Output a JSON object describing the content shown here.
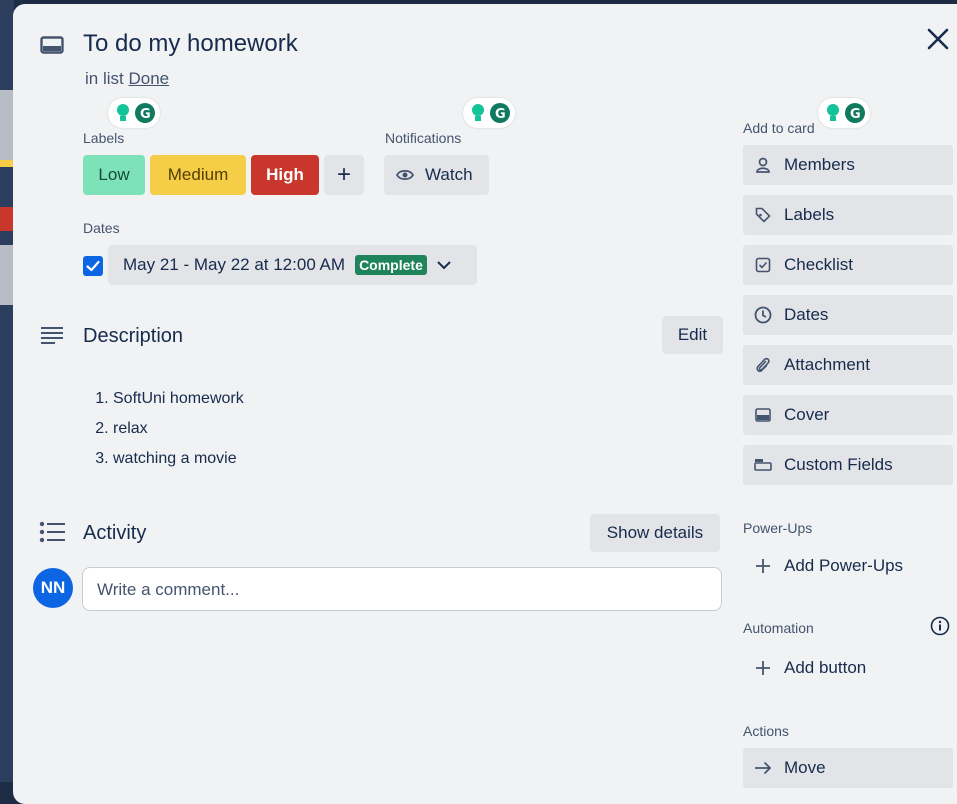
{
  "card": {
    "title": "To do my homework",
    "in_list_prefix": "in list",
    "list_name": "Done"
  },
  "labels": {
    "heading": "Labels",
    "items": [
      {
        "text": "Low",
        "color": "#7ee2b8"
      },
      {
        "text": "Medium",
        "color": "#f5cd47"
      },
      {
        "text": "High",
        "color": "#c9372c"
      }
    ],
    "add_symbol": "+"
  },
  "notifications": {
    "heading": "Notifications",
    "watch_label": "Watch"
  },
  "dates": {
    "heading": "Dates",
    "value": "May 21 - May 22 at 12:00 AM",
    "status": "Complete",
    "checked": true
  },
  "description": {
    "heading": "Description",
    "edit_label": "Edit",
    "items": [
      "SoftUni homework",
      "relax",
      "watching a movie"
    ]
  },
  "activity": {
    "heading": "Activity",
    "show_details_label": "Show details",
    "comment_placeholder": "Write a comment...",
    "avatar_initials": "NN"
  },
  "sidebar": {
    "add_to_card_heading": "Add to card",
    "add_to_card": [
      {
        "label": "Members",
        "icon": "person-icon"
      },
      {
        "label": "Labels",
        "icon": "tag-icon"
      },
      {
        "label": "Checklist",
        "icon": "checkbox-icon"
      },
      {
        "label": "Dates",
        "icon": "clock-icon"
      },
      {
        "label": "Attachment",
        "icon": "paperclip-icon"
      },
      {
        "label": "Cover",
        "icon": "cover-icon"
      },
      {
        "label": "Custom Fields",
        "icon": "fields-icon"
      }
    ],
    "powerups_heading": "Power-Ups",
    "add_powerups_label": "Add Power-Ups",
    "automation_heading": "Automation",
    "add_button_label": "Add button",
    "actions_heading": "Actions",
    "move_label": "Move"
  },
  "colors": {
    "accent": "#0c66e4",
    "complete_badge": "#1f845a",
    "modal_bg": "#f1f2f4",
    "button_bg": "#e2e4e8"
  }
}
